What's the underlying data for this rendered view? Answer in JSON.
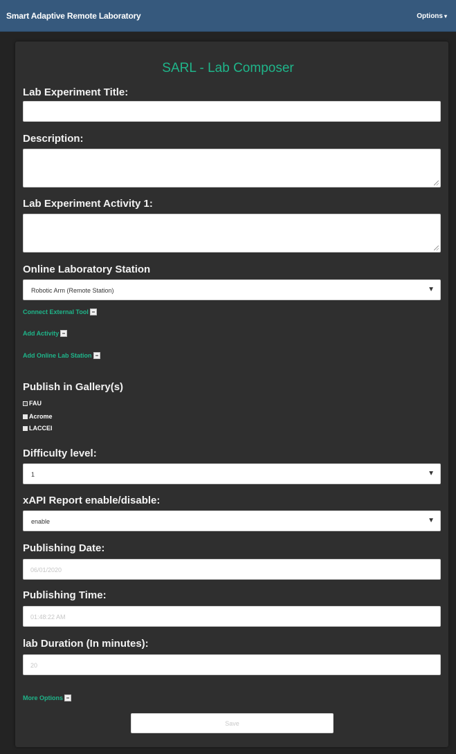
{
  "navbar": {
    "brand": "Smart Adaptive Remote Laboratory",
    "options_label": "Options"
  },
  "form": {
    "heading": "SARL - Lab Composer",
    "title_label": "Lab Experiment Title:",
    "title_value": "",
    "description_label": "Description:",
    "description_value": "",
    "activity_label": "Lab Experiment Activity 1:",
    "activity_value": "",
    "station_label": "Online Laboratory Station",
    "station_selected": "Robotic Arm (Remote Station)",
    "connect_tool_link": "Connect External Tool",
    "add_activity_link": "Add Activity",
    "add_station_link": "Add Online Lab Station",
    "publish_label": "Publish in Gallery(s)",
    "galleries": [
      {
        "name": "FAU",
        "checked": true
      },
      {
        "name": "Acrome",
        "checked": false
      },
      {
        "name": "LACCEI",
        "checked": false
      }
    ],
    "difficulty_label": "Difficulty level:",
    "difficulty_selected": "1",
    "xapi_label": "xAPI Report enable/disable:",
    "xapi_selected": "enable",
    "date_label": "Publishing Date:",
    "date_value": "06/01/2020",
    "time_label": "Publishing Time:",
    "time_value": "01:48:22 AM",
    "duration_label": "lab Duration (In minutes):",
    "duration_value": "20",
    "more_options_link": "More Options",
    "save_label": "Save"
  }
}
